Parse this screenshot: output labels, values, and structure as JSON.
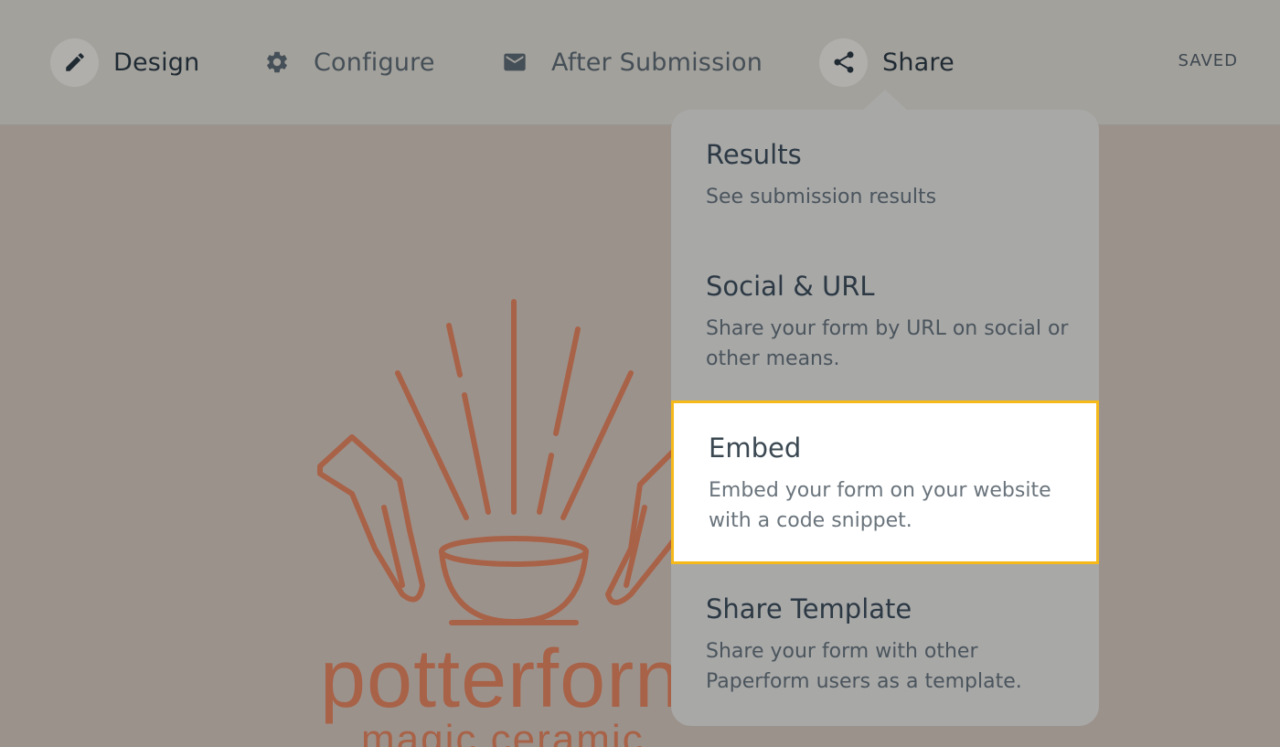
{
  "nav": {
    "items": [
      {
        "label": "Design",
        "icon": "pencil-icon"
      },
      {
        "label": "Configure",
        "icon": "gear-icon"
      },
      {
        "label": "After Submission",
        "icon": "envelope-icon"
      },
      {
        "label": "Share",
        "icon": "share-icon"
      }
    ],
    "status": "SAVED"
  },
  "background": {
    "logo_wordmark": "potterforn",
    "logo_subtitle": "magic ceramic",
    "logo_color": "#a86247"
  },
  "share_menu": {
    "items": [
      {
        "title": "Results",
        "description": "See submission results"
      },
      {
        "title": "Social & URL",
        "description": "Share your form by URL on social or other means."
      },
      {
        "title": "Embed",
        "description": "Embed your form on your website with a code snippet."
      },
      {
        "title": "Share Template",
        "description": "Share your form with other Paperform users as a template."
      }
    ],
    "highlighted": "Embed",
    "highlight_color": "#f5b91a"
  }
}
